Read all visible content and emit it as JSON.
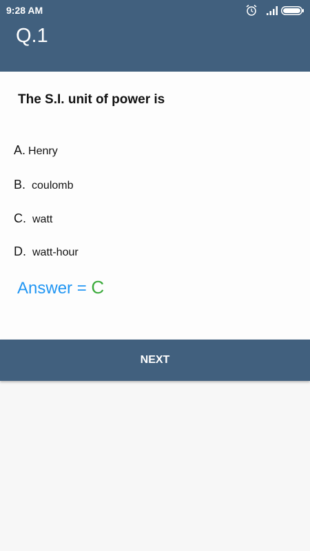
{
  "status_bar": {
    "time": "9:28 AM",
    "icons": [
      "alarm-icon",
      "signal-icon",
      "battery-icon"
    ]
  },
  "app_bar": {
    "title": "Q.1"
  },
  "question": {
    "text": "The S.I. unit of power is",
    "options": [
      {
        "letter": "A.",
        "text": "Henry"
      },
      {
        "letter": "B.",
        "text": "coulomb"
      },
      {
        "letter": "C.",
        "text": "watt"
      },
      {
        "letter": "D.",
        "text": "watt-hour"
      }
    ]
  },
  "answer": {
    "label": "Answer = ",
    "value": "C"
  },
  "next_button": {
    "label": "NEXT"
  },
  "colors": {
    "primary": "#41607e",
    "answer_label": "#2196f3",
    "answer_value": "#3aaa3a"
  }
}
